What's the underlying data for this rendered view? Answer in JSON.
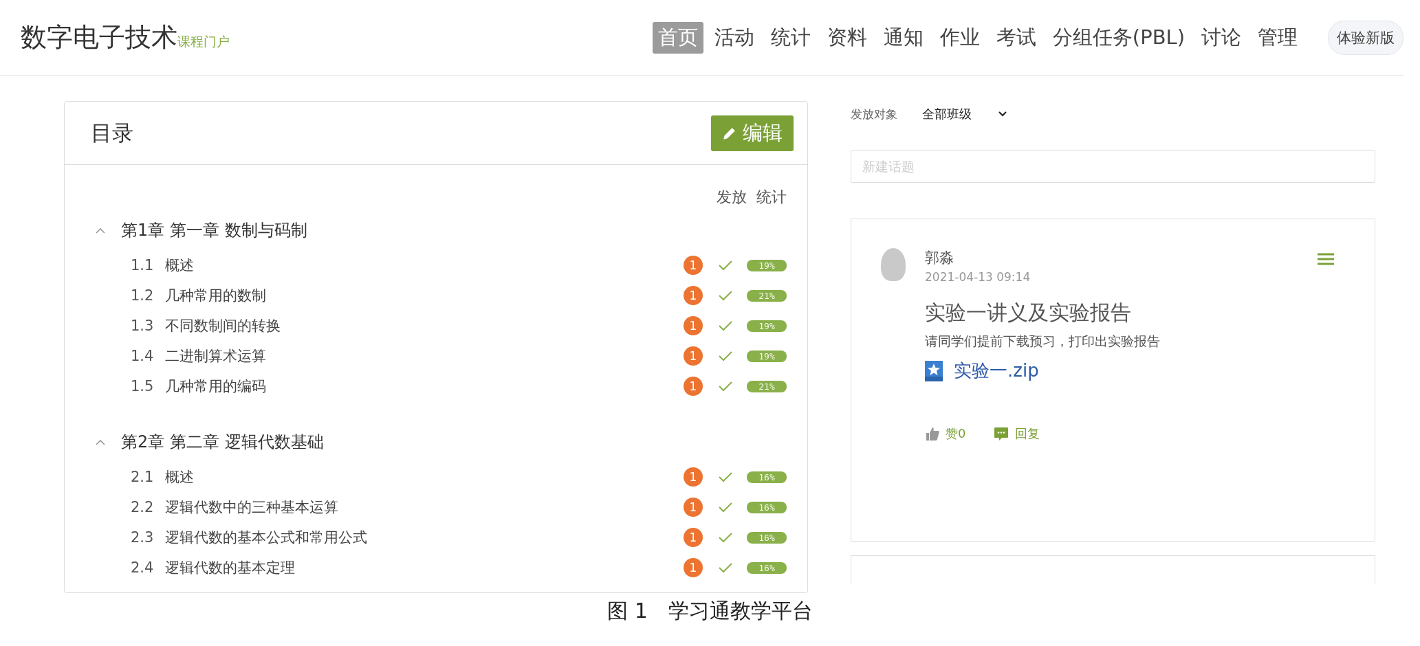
{
  "header": {
    "title": "数字电子技术",
    "subtitle": "课程门户",
    "nav": [
      {
        "label": "首页",
        "selected": true
      },
      {
        "label": "活动",
        "selected": false
      },
      {
        "label": "统计",
        "selected": false
      },
      {
        "label": "资料",
        "selected": false
      },
      {
        "label": "通知",
        "selected": false
      },
      {
        "label": "作业",
        "selected": false
      },
      {
        "label": "考试",
        "selected": false
      },
      {
        "label": "分组任务(PBL)",
        "selected": false
      },
      {
        "label": "讨论",
        "selected": false
      },
      {
        "label": "管理",
        "selected": false
      }
    ],
    "new_version_button": "体验新版"
  },
  "catalog": {
    "title": "目录",
    "edit_button": "编辑",
    "columns": [
      "发放",
      "统计"
    ],
    "chapters": [
      {
        "title": "第1章 第一章 数制与码制",
        "expanded": true,
        "children": [
          {
            "number": "1.1",
            "title": "概述",
            "badge": "1",
            "stat": "19%"
          },
          {
            "number": "1.2",
            "title": "几种常用的数制",
            "badge": "1",
            "stat": "21%"
          },
          {
            "number": "1.3",
            "title": "不同数制间的转换",
            "badge": "1",
            "stat": "19%"
          },
          {
            "number": "1.4",
            "title": "二进制算术运算",
            "badge": "1",
            "stat": "19%"
          },
          {
            "number": "1.5",
            "title": "几种常用的编码",
            "badge": "1",
            "stat": "21%"
          }
        ]
      },
      {
        "title": "第2章 第二章 逻辑代数基础",
        "expanded": true,
        "children": [
          {
            "number": "2.1",
            "title": "概述",
            "badge": "1",
            "stat": "16%"
          },
          {
            "number": "2.2",
            "title": "逻辑代数中的三种基本运算",
            "badge": "1",
            "stat": "16%"
          },
          {
            "number": "2.3",
            "title": "逻辑代数的基本公式和常用公式",
            "badge": "1",
            "stat": "16%"
          },
          {
            "number": "2.4",
            "title": "逻辑代数的基本定理",
            "badge": "1",
            "stat": "16%"
          }
        ]
      }
    ]
  },
  "discussion": {
    "audience_label": "发放对象",
    "audience_value": "全部班级",
    "new_topic": {
      "placeholder": "新建话题"
    },
    "posts": [
      {
        "author": "郭淼",
        "time": "2021-04-13 09:14",
        "title": "实验一讲义及实验报告",
        "body": "请同学们提前下载预习，打印出实验报告",
        "attachment": "实验一.zip",
        "likes": "赞0",
        "reply": "回复"
      }
    ]
  },
  "caption": "图 1　学习通教学平台"
}
